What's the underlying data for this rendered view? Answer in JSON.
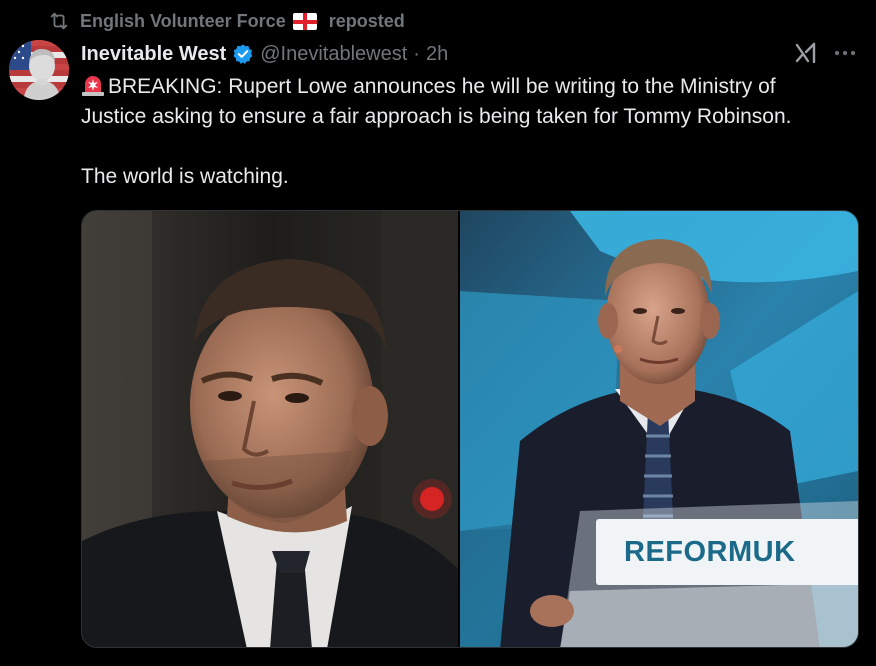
{
  "repost": {
    "user": "English Volunteer Force",
    "label": "reposted",
    "icon": "repost-icon"
  },
  "author": {
    "display_name": "Inevitable West",
    "handle": "@Inevitablewest",
    "separator": "·",
    "time": "2h",
    "verified": true
  },
  "tweet": {
    "line1": "BREAKING: Rupert Lowe announces he will be writing to the Ministry of",
    "line2": "Justice asking to ensure a fair approach is being taken for Tommy Robinson.",
    "line3": "The world is watching."
  },
  "media": {
    "podium_text": "REFORMUK"
  },
  "colors": {
    "background": "#000000",
    "text": "#e7e9ea",
    "muted": "#71767b",
    "verified": "#1d9bf0",
    "reform_teal": "#1b6a8a"
  }
}
